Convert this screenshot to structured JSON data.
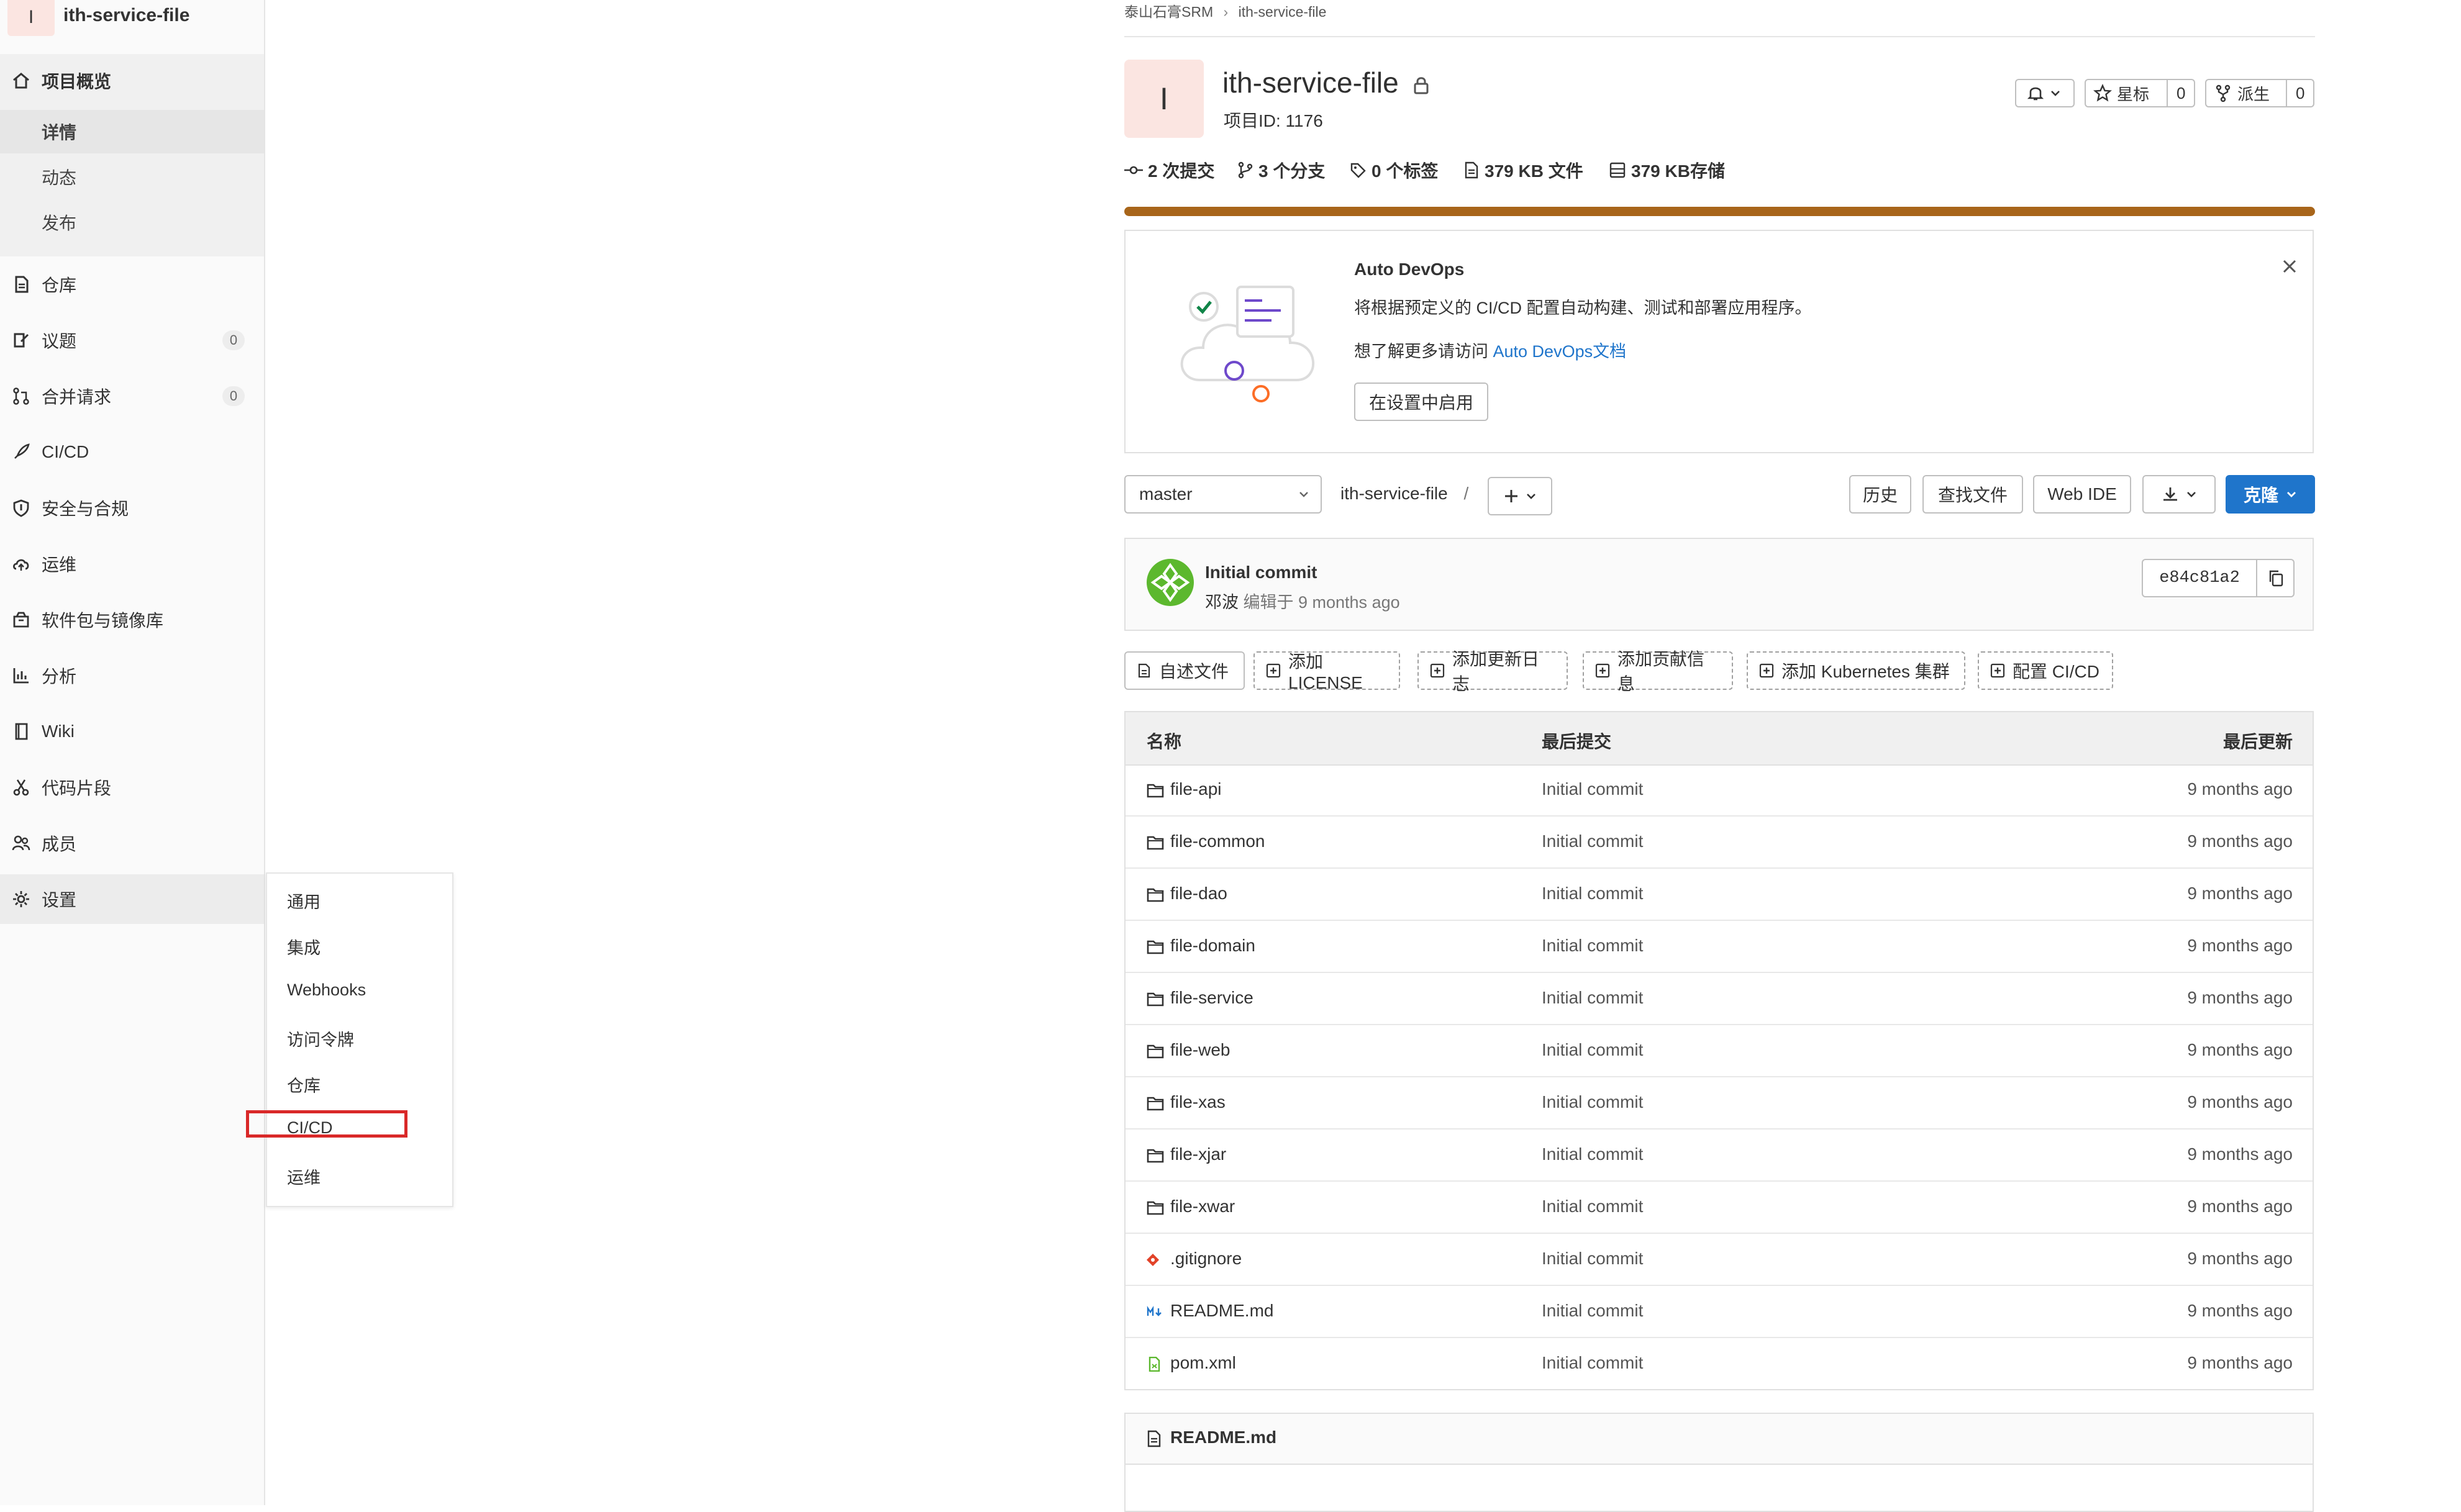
{
  "sidebar": {
    "avatar_letter": "I",
    "project_name": "ith-service-file",
    "overview_label": "项目概览",
    "overview_sub": [
      "详情",
      "动态",
      "发布"
    ],
    "items": [
      {
        "label": "仓库",
        "icon": "document-icon"
      },
      {
        "label": "议题",
        "icon": "issues-icon",
        "count": "0"
      },
      {
        "label": "合并请求",
        "icon": "merge-request-icon",
        "count": "0"
      },
      {
        "label": "CI/CD",
        "icon": "rocket-icon"
      },
      {
        "label": "安全与合规",
        "icon": "shield-icon"
      },
      {
        "label": "运维",
        "icon": "cloud-icon"
      },
      {
        "label": "软件包与镜像库",
        "icon": "package-icon"
      },
      {
        "label": "分析",
        "icon": "chart-icon"
      },
      {
        "label": "Wiki",
        "icon": "book-icon"
      },
      {
        "label": "代码片段",
        "icon": "scissors-icon"
      },
      {
        "label": "成员",
        "icon": "users-icon"
      },
      {
        "label": "设置",
        "icon": "gear-icon"
      }
    ],
    "settings_flyout": [
      "通用",
      "集成",
      "Webhooks",
      "访问令牌",
      "仓库",
      "CI/CD",
      "运维"
    ]
  },
  "breadcrumb": [
    "泰山石膏SRM",
    "ith-service-file"
  ],
  "project": {
    "avatar_letter": "I",
    "title": "ith-service-file",
    "id_text": "项目ID: 1176",
    "star_label": "星标",
    "star_count": "0",
    "fork_label": "派生",
    "fork_count": "0"
  },
  "stats": {
    "commits": "2 次提交",
    "branches": "3 个分支",
    "tags": "0 个标签",
    "files": "379 KB 文件",
    "storage": "379 KB存储"
  },
  "devops": {
    "title": "Auto DevOps",
    "desc": "将根据预定义的 CI/CD 配置自动构建、测试和部署应用程序。",
    "more_prefix": "想了解更多请访问 ",
    "more_link": "Auto DevOps文档",
    "enable_button": "在设置中启用"
  },
  "repo_bar": {
    "branch": "master",
    "path": "ith-service-file",
    "sep": "/",
    "history": "历史",
    "find_file": "查找文件",
    "web_ide": "Web IDE",
    "clone": "克隆"
  },
  "last_commit": {
    "message": "Initial commit",
    "author": "邓波",
    "edited": " 编辑于 9 months ago",
    "sha": "e84c81a2"
  },
  "quick_actions": [
    "自述文件",
    "添加LICENSE",
    "添加更新日志",
    "添加贡献信息",
    "添加 Kubernetes 集群",
    "配置 CI/CD"
  ],
  "table": {
    "headers": {
      "name": "名称",
      "commit": "最后提交",
      "updated": "最后更新"
    },
    "rows": [
      {
        "name": "file-api",
        "type": "folder",
        "commit": "Initial commit",
        "updated": "9 months ago"
      },
      {
        "name": "file-common",
        "type": "folder",
        "commit": "Initial commit",
        "updated": "9 months ago"
      },
      {
        "name": "file-dao",
        "type": "folder",
        "commit": "Initial commit",
        "updated": "9 months ago"
      },
      {
        "name": "file-domain",
        "type": "folder",
        "commit": "Initial commit",
        "updated": "9 months ago"
      },
      {
        "name": "file-service",
        "type": "folder",
        "commit": "Initial commit",
        "updated": "9 months ago"
      },
      {
        "name": "file-web",
        "type": "folder",
        "commit": "Initial commit",
        "updated": "9 months ago"
      },
      {
        "name": "file-xas",
        "type": "folder",
        "commit": "Initial commit",
        "updated": "9 months ago"
      },
      {
        "name": "file-xjar",
        "type": "folder",
        "commit": "Initial commit",
        "updated": "9 months ago"
      },
      {
        "name": "file-xwar",
        "type": "folder",
        "commit": "Initial commit",
        "updated": "9 months ago"
      },
      {
        "name": ".gitignore",
        "type": "git",
        "commit": "Initial commit",
        "updated": "9 months ago"
      },
      {
        "name": "README.md",
        "type": "markdown",
        "commit": "Initial commit",
        "updated": "9 months ago"
      },
      {
        "name": "pom.xml",
        "type": "xml",
        "commit": "Initial commit",
        "updated": "9 months ago"
      }
    ]
  },
  "readme": {
    "title": "README.md"
  },
  "colors": {
    "accent": "#1f75cb",
    "progress": "#a8651a",
    "highlight": "#d92828",
    "avatar_bg": "#fbe5e1"
  }
}
